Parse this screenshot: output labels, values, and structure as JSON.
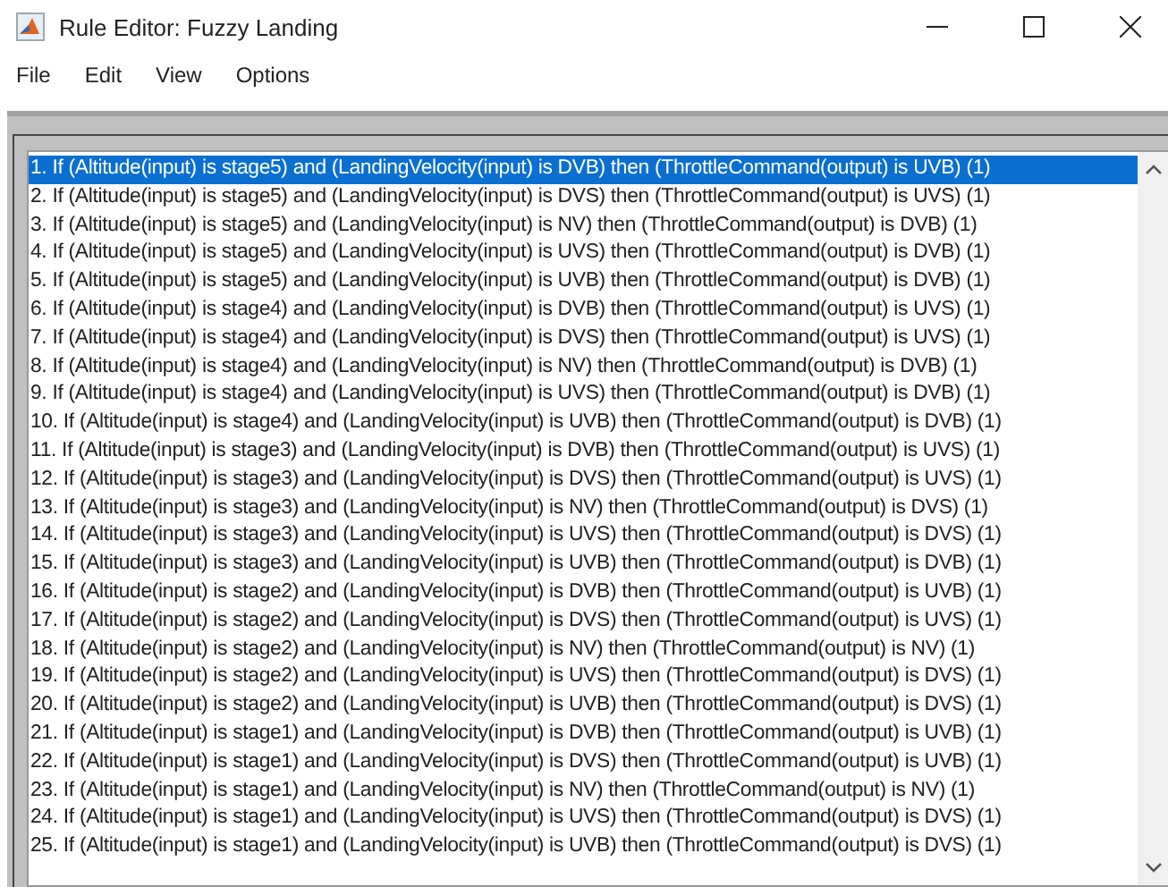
{
  "window": {
    "title": "Rule Editor: Fuzzy Landing"
  },
  "menu": [
    "File",
    "Edit",
    "View",
    "Options"
  ],
  "rules": [
    {
      "text": "1. If (Altitude(input) is stage5) and (LandingVelocity(input) is DVB) then (ThrottleCommand(output) is UVB) (1)",
      "selected": true
    },
    {
      "text": "2. If (Altitude(input) is stage5) and (LandingVelocity(input) is DVS) then (ThrottleCommand(output) is UVS) (1)",
      "selected": false
    },
    {
      "text": "3. If (Altitude(input) is stage5) and (LandingVelocity(input) is NV) then (ThrottleCommand(output) is DVB) (1)",
      "selected": false
    },
    {
      "text": "4. If (Altitude(input) is stage5) and (LandingVelocity(input) is UVS) then (ThrottleCommand(output) is DVB) (1)",
      "selected": false
    },
    {
      "text": "5. If (Altitude(input) is stage5) and (LandingVelocity(input) is UVB) then (ThrottleCommand(output) is DVB) (1)",
      "selected": false
    },
    {
      "text": "6. If (Altitude(input) is stage4) and (LandingVelocity(input) is DVB) then (ThrottleCommand(output) is UVS) (1)",
      "selected": false
    },
    {
      "text": "7. If (Altitude(input) is stage4) and (LandingVelocity(input) is DVS) then (ThrottleCommand(output) is UVS) (1)",
      "selected": false
    },
    {
      "text": "8. If (Altitude(input) is stage4) and (LandingVelocity(input) is NV) then (ThrottleCommand(output) is DVB) (1)",
      "selected": false
    },
    {
      "text": "9. If (Altitude(input) is stage4) and (LandingVelocity(input) is UVS) then (ThrottleCommand(output) is DVB) (1)",
      "selected": false
    },
    {
      "text": "10. If (Altitude(input) is stage4) and (LandingVelocity(input) is UVB) then (ThrottleCommand(output) is DVB) (1)",
      "selected": false
    },
    {
      "text": "11. If (Altitude(input) is stage3) and (LandingVelocity(input) is DVB) then (ThrottleCommand(output) is UVS) (1)",
      "selected": false
    },
    {
      "text": "12. If (Altitude(input) is stage3) and (LandingVelocity(input) is DVS) then (ThrottleCommand(output) is UVS) (1)",
      "selected": false
    },
    {
      "text": "13. If (Altitude(input) is stage3) and (LandingVelocity(input) is NV) then (ThrottleCommand(output) is DVS) (1)",
      "selected": false
    },
    {
      "text": "14. If (Altitude(input) is stage3) and (LandingVelocity(input) is UVS) then (ThrottleCommand(output) is DVS) (1)",
      "selected": false
    },
    {
      "text": "15. If (Altitude(input) is stage3) and (LandingVelocity(input) is UVB) then (ThrottleCommand(output) is DVB) (1)",
      "selected": false
    },
    {
      "text": "16. If (Altitude(input) is stage2) and (LandingVelocity(input) is DVB) then (ThrottleCommand(output) is UVB) (1)",
      "selected": false
    },
    {
      "text": "17. If (Altitude(input) is stage2) and (LandingVelocity(input) is DVS) then (ThrottleCommand(output) is UVS) (1)",
      "selected": false
    },
    {
      "text": "18. If (Altitude(input) is stage2) and (LandingVelocity(input) is NV) then (ThrottleCommand(output) is NV) (1)",
      "selected": false
    },
    {
      "text": "19. If (Altitude(input) is stage2) and (LandingVelocity(input) is UVS) then (ThrottleCommand(output) is DVS) (1)",
      "selected": false
    },
    {
      "text": "20. If (Altitude(input) is stage2) and (LandingVelocity(input) is UVB) then (ThrottleCommand(output) is DVS) (1)",
      "selected": false
    },
    {
      "text": "21. If (Altitude(input) is stage1) and (LandingVelocity(input) is DVB) then (ThrottleCommand(output) is UVB) (1)",
      "selected": false
    },
    {
      "text": "22. If (Altitude(input) is stage1) and (LandingVelocity(input) is DVS) then (ThrottleCommand(output) is UVB) (1)",
      "selected": false
    },
    {
      "text": "23. If (Altitude(input) is stage1) and (LandingVelocity(input) is NV) then (ThrottleCommand(output) is NV) (1)",
      "selected": false
    },
    {
      "text": "24. If (Altitude(input) is stage1) and (LandingVelocity(input) is UVS) then (ThrottleCommand(output) is DVS) (1)",
      "selected": false
    },
    {
      "text": "25. If (Altitude(input) is stage1) and (LandingVelocity(input) is UVB) then (ThrottleCommand(output) is DVS) (1)",
      "selected": false
    }
  ]
}
